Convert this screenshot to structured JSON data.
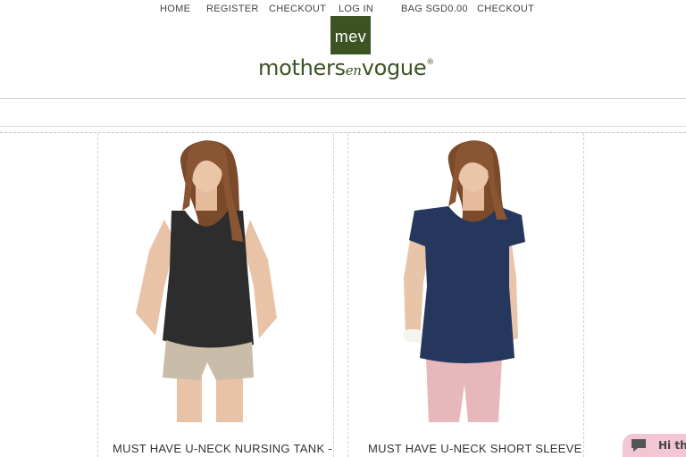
{
  "nav": {
    "home": "HOME",
    "register": "REGISTER",
    "checkout": "CHECKOUT",
    "login": "LOG IN",
    "bag": "BAG SGD0.00",
    "checkout2": "CHECKOUT"
  },
  "logo": {
    "mark": "mev",
    "word_left": "mothers",
    "word_en": "en",
    "word_right": "vogue",
    "registered": "®"
  },
  "products": [
    {
      "title": "MUST HAVE U-NECK NURSING TANK -",
      "top_color": "#2d2d2d",
      "bottom_color": "#c9bca8",
      "image": "woman-black-tank-photo"
    },
    {
      "title": "MUST HAVE U-NECK SHORT SLEEVE",
      "top_color": "#26375e",
      "bottom_color": "#e6b8bc",
      "image": "woman-navy-tee-photo"
    }
  ],
  "chat": {
    "label": "Hi th",
    "icon": "chat-bubble-icon",
    "color": "#f3c6d4"
  }
}
